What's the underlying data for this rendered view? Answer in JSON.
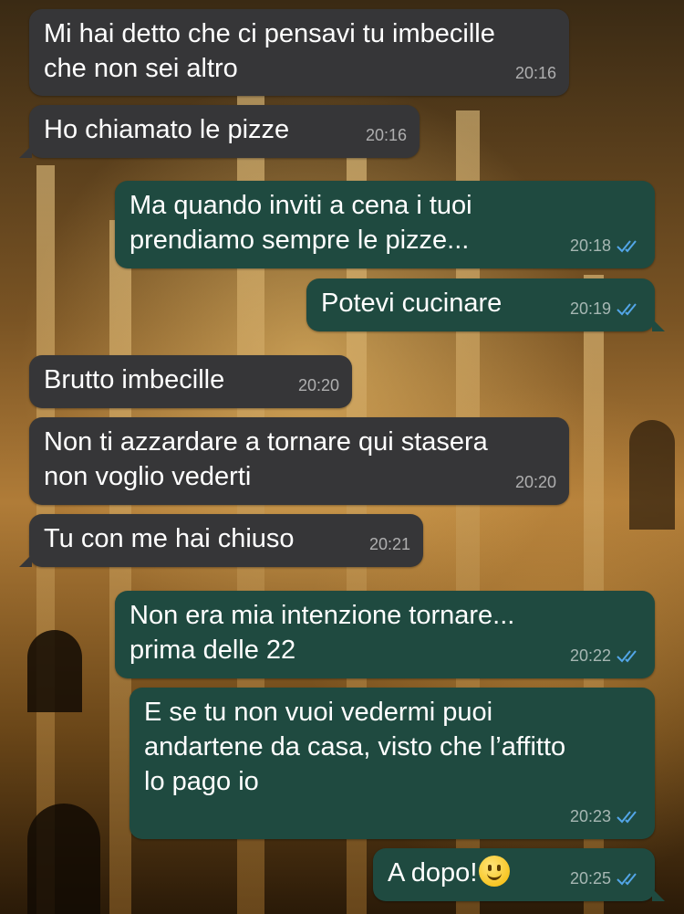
{
  "conversation": {
    "messages": [
      {
        "direction": "incoming",
        "text": "Mi hai detto che ci pensavi tu imbecille\nche non sei altro",
        "time": "20:16"
      },
      {
        "direction": "incoming",
        "text": "Ho chiamato le pizze",
        "time": "20:16"
      },
      {
        "direction": "outgoing",
        "text": "Ma quando inviti a cena i tuoi\nprendiamo sempre le pizze...",
        "time": "20:18",
        "status": "read"
      },
      {
        "direction": "outgoing",
        "text": "Potevi cucinare",
        "time": "20:19",
        "status": "read"
      },
      {
        "direction": "incoming",
        "text": "Brutto imbecille",
        "time": "20:20"
      },
      {
        "direction": "incoming",
        "text": "Non ti azzardare a tornare qui stasera\nnon voglio vederti",
        "time": "20:20"
      },
      {
        "direction": "incoming",
        "text": "Tu con me hai chiuso",
        "time": "20:21"
      },
      {
        "direction": "outgoing",
        "text": "Non era mia intenzione tornare...\nprima delle 22",
        "time": "20:22",
        "status": "read"
      },
      {
        "direction": "outgoing",
        "text": "E se tu non vuoi vedermi puoi\nandartene da casa, visto che l’affitto\nlo pago io",
        "time": "20:23",
        "status": "read"
      },
      {
        "direction": "outgoing",
        "text": "A dopo!",
        "emoji": "slightly-smiling-face",
        "time": "20:25",
        "status": "read"
      }
    ]
  },
  "colors": {
    "incoming_bubble": "#363638",
    "outgoing_bubble": "#1f4a40",
    "read_ticks": "#53a6e8"
  },
  "icons": {
    "read_receipt": "double-check-icon",
    "emoji": "slightly-smiling-face-emoji"
  }
}
